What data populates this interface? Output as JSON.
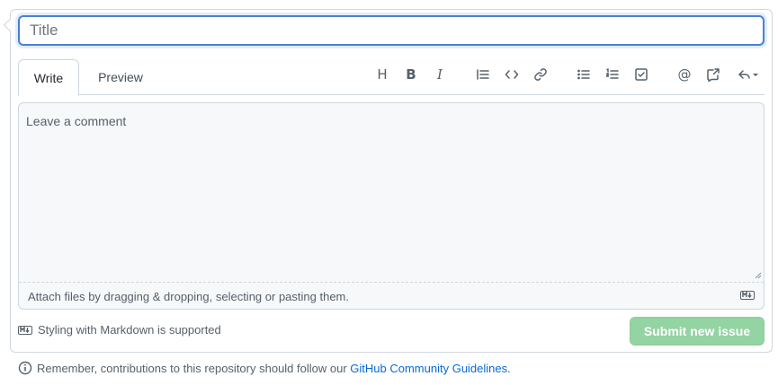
{
  "title_field": {
    "placeholder": "Title",
    "value": ""
  },
  "tabs": [
    {
      "label": "Write",
      "active": true
    },
    {
      "label": "Preview",
      "active": false
    }
  ],
  "toolbar": {
    "buttons": [
      "heading-icon",
      "bold-icon",
      "italic-icon",
      "quote-icon",
      "code-icon",
      "link-icon",
      "unordered-list-icon",
      "ordered-list-icon",
      "task-list-icon",
      "mention-icon",
      "cross-reference-icon",
      "reply-icon"
    ],
    "heading_glyph": "H",
    "bold_glyph": "B",
    "italic_glyph": "I",
    "mention_glyph": "@"
  },
  "comment": {
    "placeholder": "Leave a comment",
    "value": ""
  },
  "attach": {
    "text": "Attach files by dragging & dropping, selecting or pasting them."
  },
  "footer": {
    "markdown_note": "Styling with Markdown is supported",
    "submit_label": "Submit new issue"
  },
  "guidelines": {
    "prefix": "Remember, contributions to this repository should follow our ",
    "link_text": "GitHub Community Guidelines",
    "suffix": "."
  },
  "colors": {
    "accent": "#0969da",
    "submit_disabled": "#94d3a2",
    "focus_border": "#4a80d4"
  }
}
